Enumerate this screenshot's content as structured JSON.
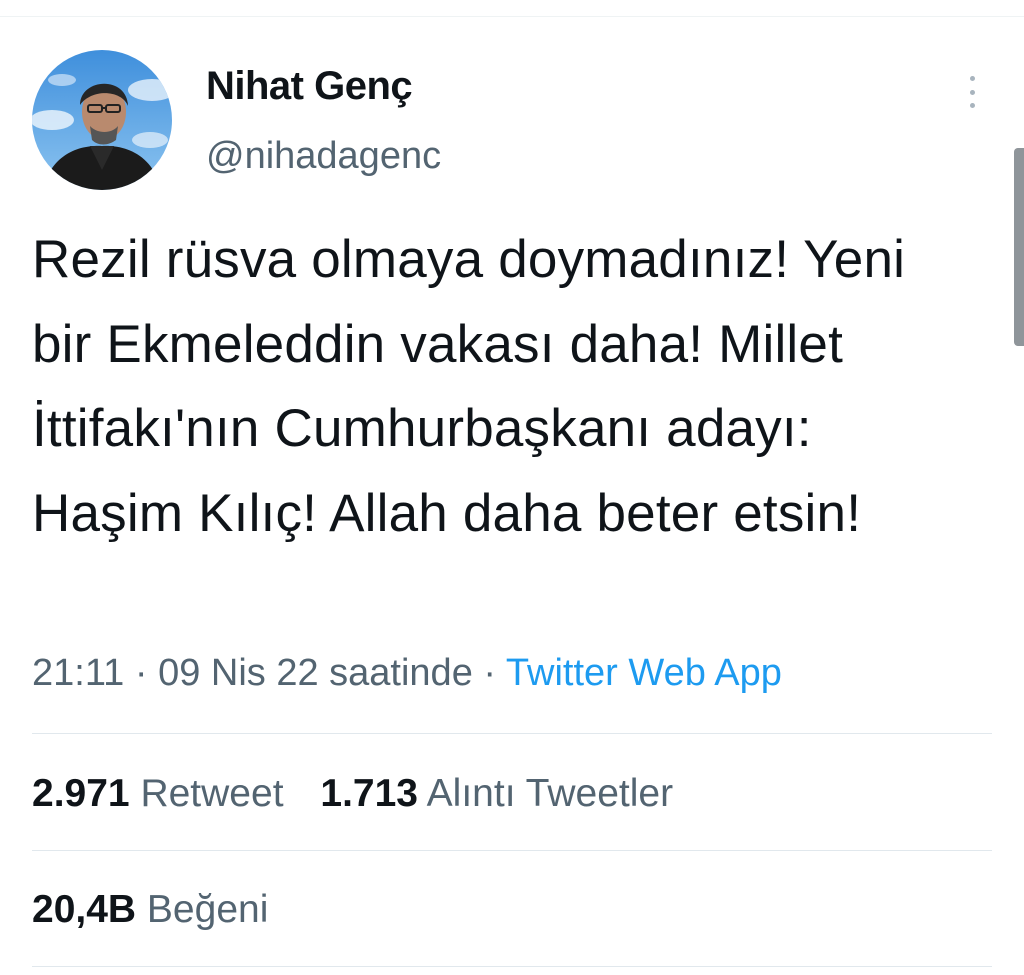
{
  "tweet": {
    "author": {
      "display_name": "Nihat Genç",
      "handle": "@nihadagenc"
    },
    "text": "Rezil rüsva olmaya doymadınız! Yeni bir Ekmeleddin vakası daha! Millet İttifakı'nın Cumhurbaşkanı adayı: Haşim Kılıç! Allah daha beter etsin!",
    "time": "21:11",
    "separator": "·",
    "date": "09 Nis 22 saatinde",
    "source": "Twitter Web App"
  },
  "stats": {
    "retweets": {
      "value": "2.971",
      "label": "Retweet"
    },
    "quotes": {
      "value": "1.713",
      "label": "Alıntı Tweetler"
    },
    "likes": {
      "value": "20,4B",
      "label": "Beğeni"
    }
  },
  "icons": {
    "more": "more-vertical-icon"
  },
  "colors": {
    "text": "#0f1419",
    "secondary": "#536471",
    "link": "#1d9bf0",
    "divider": "#e1e8ed"
  }
}
